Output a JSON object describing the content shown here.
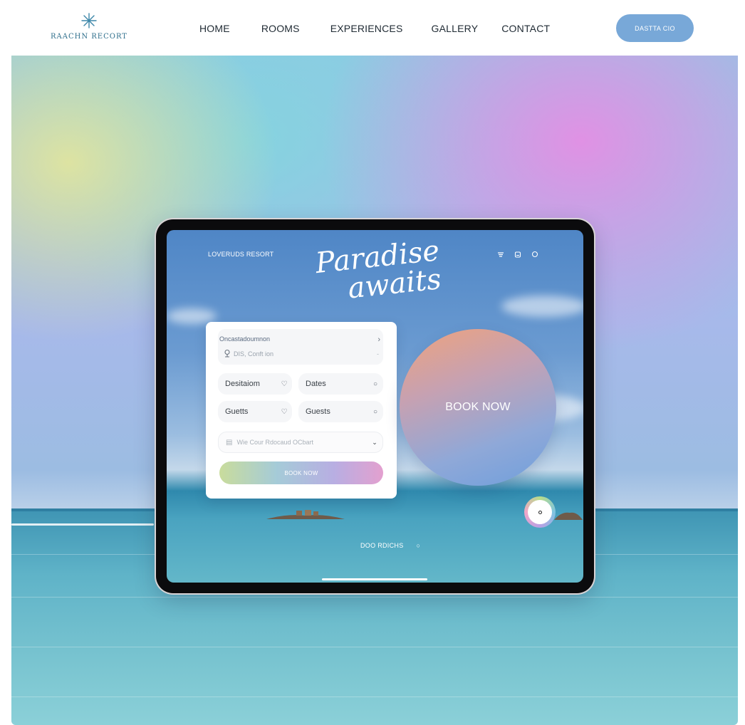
{
  "site": {
    "logo_text": "RAACHN RECORT",
    "nav": [
      "HOME",
      "ROOMS",
      "EXPERIENCES",
      "GALLERY",
      "CONTACT"
    ],
    "cta_label": "DASTTA CIO"
  },
  "tablet": {
    "brand": "LOVERUDS RESORT",
    "title_line1": "Paradise",
    "title_line2": "awaits",
    "booking": {
      "search_label": "Oncastadoumnon",
      "search_placeholder": "DIS, Conft ion",
      "destination": "Desitaiom",
      "dates": "Dates",
      "guests_left": "Guetts",
      "guests_right": "Guests",
      "select_placeholder": "Wie Cour Rdocaud OCbart",
      "button": "BOOK NOW"
    },
    "book_now_orb": "BOOK NOW",
    "footer_text": "DOO RDICHS"
  },
  "colors": {
    "cta": "#78a8d8",
    "logo": "#2f6f8c",
    "orb_start": "#efa27c",
    "orb_end": "#6f9fdc"
  },
  "icons": {
    "logo": "starburst-icon",
    "menu": "menu-icon",
    "bag": "bag-icon",
    "profile": "circle-icon",
    "pin": "location-pin-icon",
    "chevron": "chevron-right-icon",
    "heart": "heart-icon",
    "calendar": "calendar-icon",
    "dropdown": "chevron-down-icon"
  }
}
